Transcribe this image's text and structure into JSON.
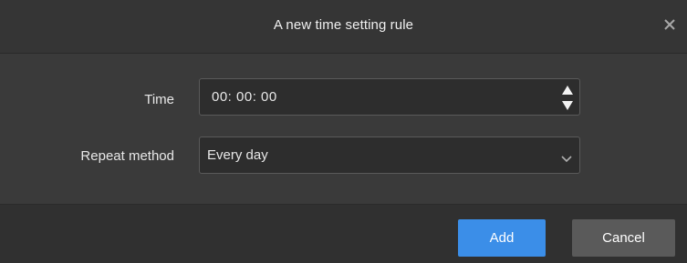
{
  "dialog": {
    "title": "A new time setting rule",
    "close_icon": "close-icon"
  },
  "form": {
    "time_label": "Time",
    "time_value": "00: 00: 00",
    "repeat_label": "Repeat method",
    "repeat_value": "Every day"
  },
  "footer": {
    "add_label": "Add",
    "cancel_label": "Cancel"
  },
  "colors": {
    "accent": "#3b8ee8",
    "background": "#3a3a3a",
    "secondary_button": "#5a5a5a"
  }
}
